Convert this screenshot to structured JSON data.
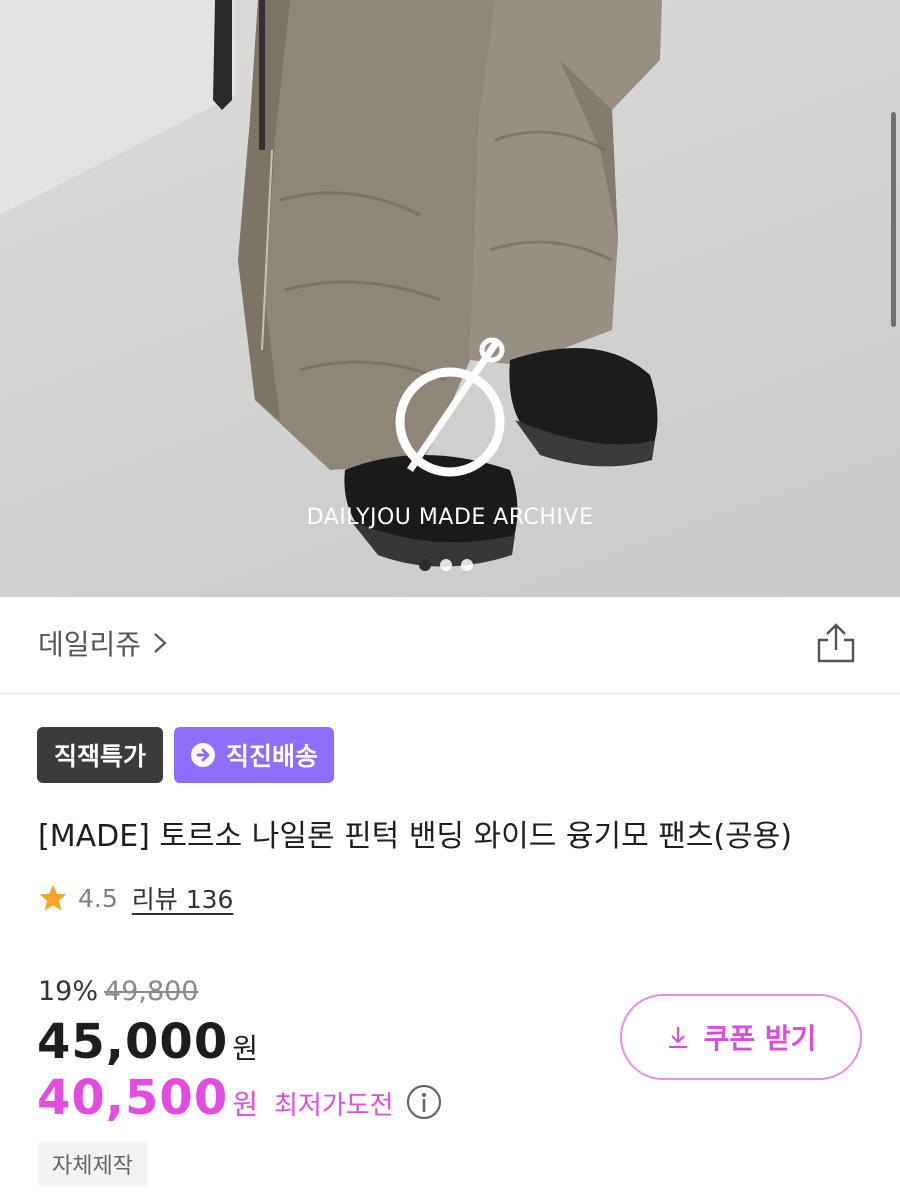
{
  "hero": {
    "watermark": "DAILYJOU MADE ARCHIVE",
    "carousel_count": 3,
    "carousel_active_index": 0
  },
  "store": {
    "name": "데일리쥬",
    "chevron_icon": "chevron-right-icon",
    "share_icon": "share-icon"
  },
  "badges": [
    {
      "label": "직잭특가",
      "color": "#3b3b3d"
    },
    {
      "label": "직진배송",
      "color": "#8d6dfa",
      "icon": "delivery-icon"
    }
  ],
  "product": {
    "title": "[MADE] 토르소 나일론 핀턱 밴딩 와이드 융기모 팬츠(공용)",
    "rating": "4.5",
    "review_label": "리뷰 136"
  },
  "price": {
    "discount_rate": "19%",
    "original": "49,800",
    "sale": "45,000",
    "won": "원",
    "best": "40,500",
    "best_label": "최저가도전",
    "accent_color": "#e44be0"
  },
  "coupon": {
    "label": "쿠폰 받기",
    "icon": "download-icon"
  },
  "tag": {
    "label": "자체제작"
  }
}
